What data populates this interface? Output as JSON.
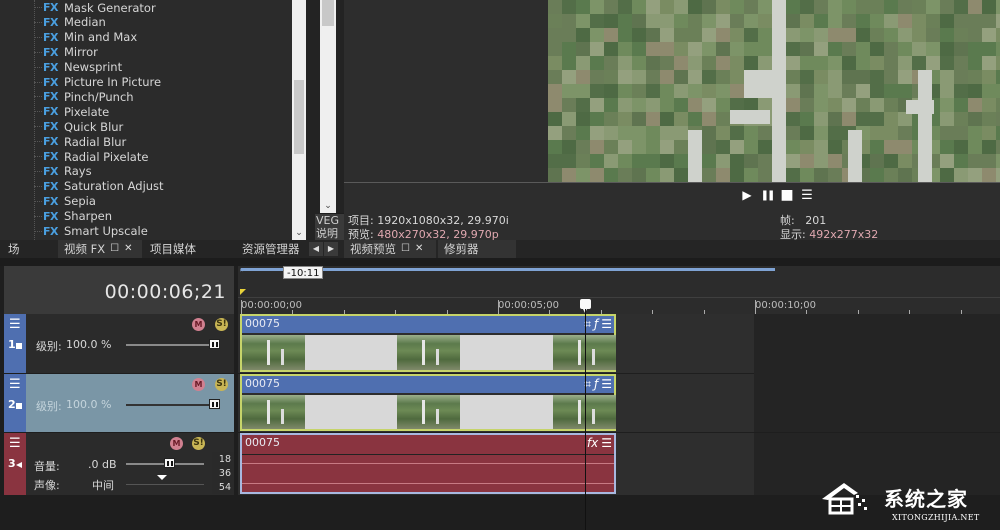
{
  "fx_browser": {
    "items": [
      {
        "tag": "FX",
        "label": "Mask Generator"
      },
      {
        "tag": "FX",
        "label": "Median"
      },
      {
        "tag": "FX",
        "label": "Min and Max"
      },
      {
        "tag": "FX",
        "label": "Mirror"
      },
      {
        "tag": "FX",
        "label": "Newsprint"
      },
      {
        "tag": "FX",
        "label": "Picture In Picture"
      },
      {
        "tag": "FX",
        "label": "Pinch/Punch"
      },
      {
        "tag": "FX",
        "label": "Pixelate"
      },
      {
        "tag": "FX",
        "label": "Quick Blur"
      },
      {
        "tag": "FX",
        "label": "Radial Blur"
      },
      {
        "tag": "FX",
        "label": "Radial Pixelate"
      },
      {
        "tag": "FX",
        "label": "Rays"
      },
      {
        "tag": "FX",
        "label": "Saturation Adjust"
      },
      {
        "tag": "FX",
        "label": "Sepia"
      },
      {
        "tag": "FX",
        "label": "Sharpen"
      },
      {
        "tag": "FX",
        "label": "Smart Upscale"
      }
    ],
    "side_text_line1": "VEG",
    "side_text_line2": "说明"
  },
  "tabs_left": [
    {
      "label": "场"
    },
    {
      "label": "视频 FX",
      "active": true
    },
    {
      "label": "项目媒体"
    },
    {
      "label": "资源管理器"
    }
  ],
  "tabs_right": [
    {
      "label": "视频预览",
      "active": true
    },
    {
      "label": "修剪器"
    }
  ],
  "preview": {
    "project_label": "项目:",
    "project_value": "1920x1080x32, 29.970i",
    "preview_label": "预览:",
    "preview_value": "480x270x32, 29.970p",
    "frame_label": "帧:",
    "frame_value": "201",
    "display_label": "显示:",
    "display_value": "492x277x32",
    "transport": {
      "play": "▶",
      "pause": "❚❚",
      "stop": "■",
      "menu": "☰"
    }
  },
  "timeline": {
    "timecode": "00:00:06;21",
    "loop_region_label": "-10:11",
    "ruler_labels": [
      "00:00:00;00",
      "00:00:05;00",
      "00:00:10;00"
    ]
  },
  "tracks": [
    {
      "number": "1",
      "type": "video",
      "level_label": "级别:",
      "level_value": "100.0 %",
      "level_fraction": 1.0,
      "clip_name": "00075",
      "color": "#4f6fb0"
    },
    {
      "number": "2",
      "type": "video",
      "level_label": "级别:",
      "level_value": "100.0 %",
      "level_fraction": 1.0,
      "clip_name": "00075",
      "color": "#4f6fb0",
      "selected": true
    },
    {
      "number": "3",
      "type": "audio",
      "volume_label": "音量:",
      "volume_value": ".0 dB",
      "pan_label": "声像:",
      "pan_value": "中间",
      "clip_name": "00075",
      "color": "#8a3440",
      "db_scale": [
        "18",
        "36",
        "54"
      ]
    }
  ],
  "icons": {
    "mute": "M",
    "solo": "S!",
    "menu": "☰",
    "crop": "⌗",
    "fx": "fx"
  },
  "watermark": {
    "text": "系统之家",
    "url": "XITONGZHIJIA.NET"
  }
}
